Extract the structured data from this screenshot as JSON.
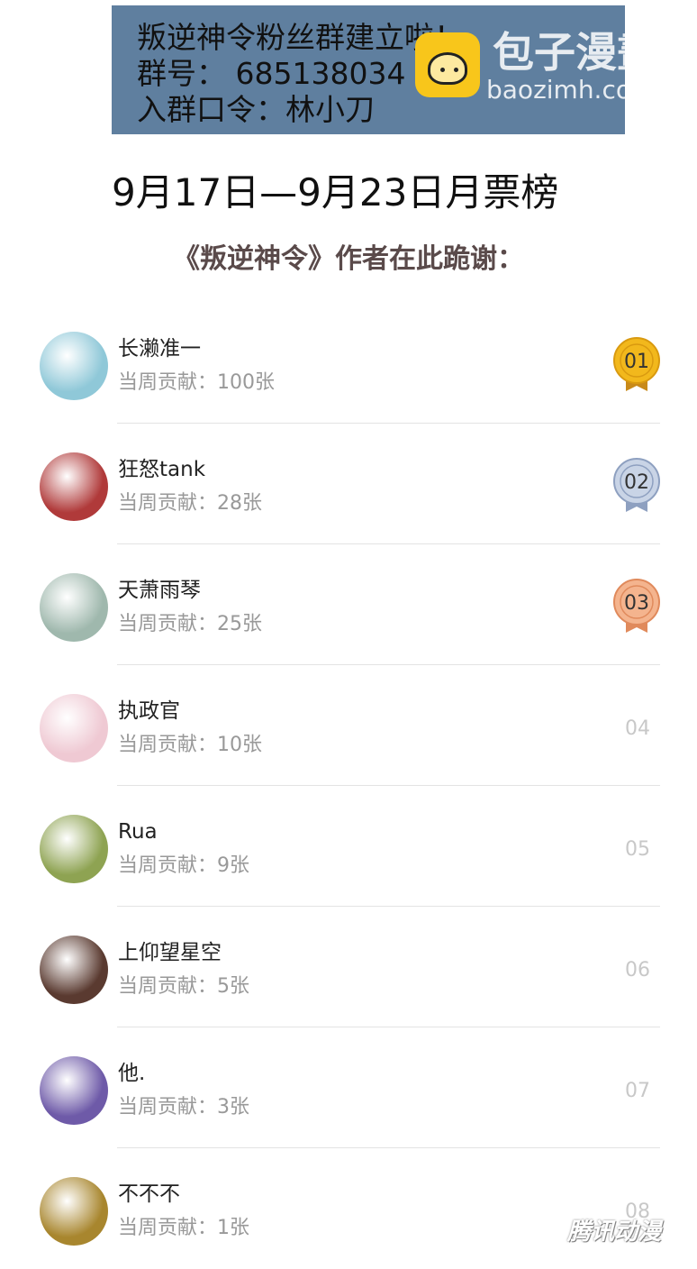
{
  "banner": {
    "line1": "叛逆神令粉丝群建立啦！",
    "line2": "群号： 685138034",
    "line3": "入群口令：林小刀"
  },
  "watermark": {
    "logo_cn": "包子漫畫",
    "logo_en": "baozimh.com",
    "corner": "腾讯动漫"
  },
  "title": "9月17日—9月23日月票榜",
  "subtitle": "《叛逆神令》作者在此跪谢：",
  "ranking": [
    {
      "rank": "01",
      "name": "长濑准一",
      "contribution": "当周贡献：100张",
      "avatar_color": "#8fc8d8",
      "medal": "gold"
    },
    {
      "rank": "02",
      "name": "狂怒tank",
      "contribution": "当周贡献：28张",
      "avatar_color": "#b03a3a",
      "medal": "silver"
    },
    {
      "rank": "03",
      "name": "天萧雨琴",
      "contribution": "当周贡献：25张",
      "avatar_color": "#9fb8ad",
      "medal": "bronze"
    },
    {
      "rank": "04",
      "name": "执政官",
      "contribution": "当周贡献：10张",
      "avatar_color": "#efc9d3",
      "medal": ""
    },
    {
      "rank": "05",
      "name": "Rua",
      "contribution": "当周贡献：9张",
      "avatar_color": "#8ea352",
      "medal": ""
    },
    {
      "rank": "06",
      "name": "上仰望星空",
      "contribution": "当周贡献：5张",
      "avatar_color": "#5a3a30",
      "medal": ""
    },
    {
      "rank": "07",
      "name": "他.",
      "contribution": "当周贡献：3张",
      "avatar_color": "#6e5aa8",
      "medal": ""
    },
    {
      "rank": "08",
      "name": "不不不",
      "contribution": "当周贡献：1张",
      "avatar_color": "#a8862e",
      "medal": ""
    }
  ],
  "colors": {
    "banner_bg": "#5f7f9f",
    "gold": "#f2b81c",
    "silver": "#b9c7de",
    "bronze": "#f1a478"
  }
}
